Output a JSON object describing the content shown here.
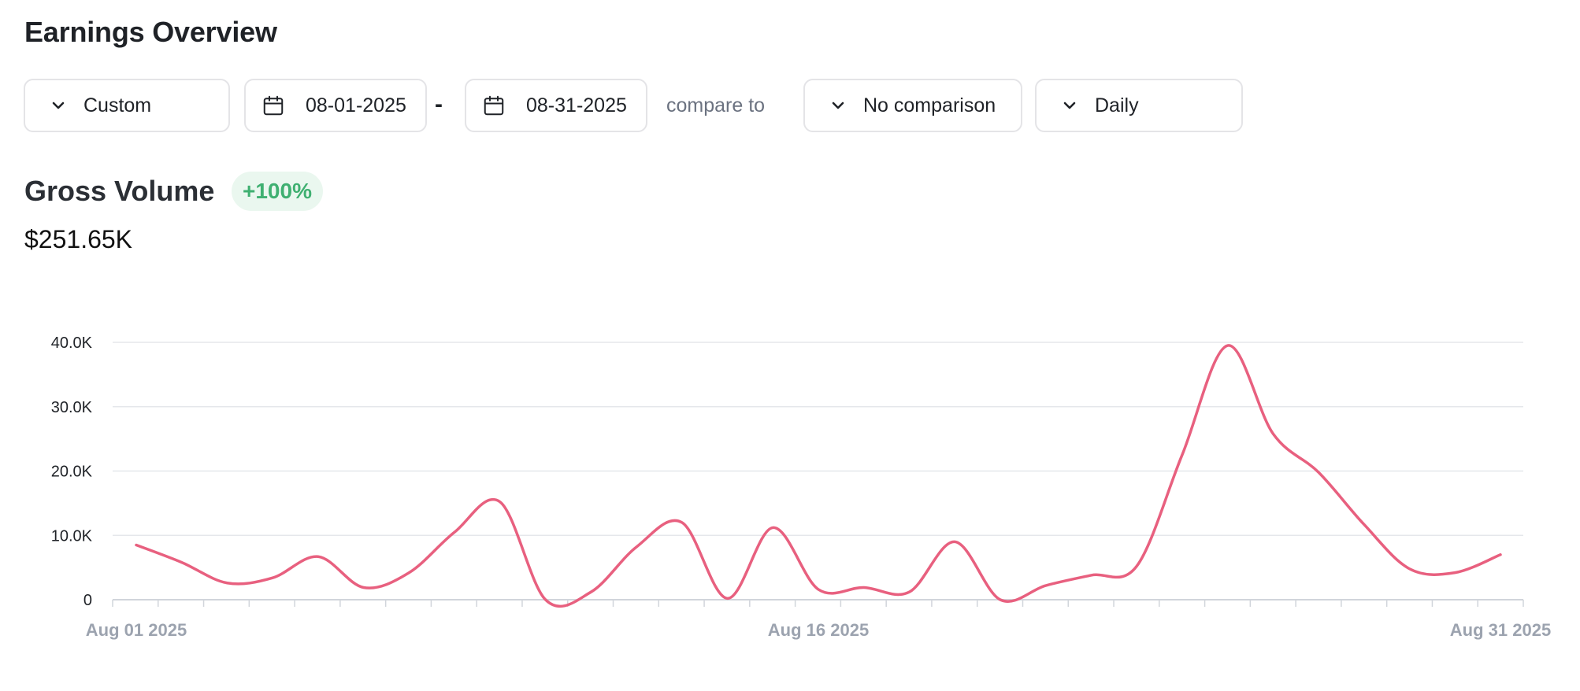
{
  "page": {
    "title": "Earnings Overview"
  },
  "filters": {
    "range_preset": "Custom",
    "start_date": "08-01-2025",
    "separator": "-",
    "end_date": "08-31-2025",
    "compare_label": "compare to",
    "comparison": "No comparison",
    "interval": "Daily"
  },
  "metric": {
    "title": "Gross Volume",
    "change_badge": "+100%",
    "value": "$251.65K"
  },
  "colors": {
    "line": "#e8607f",
    "badge_bg": "#eaf7ef",
    "badge_text": "#3fb071",
    "grid": "#e5e7eb",
    "axis_text": "#9ca3af"
  },
  "chart_data": {
    "type": "line",
    "x": [
      "Aug 01",
      "Aug 02",
      "Aug 03",
      "Aug 04",
      "Aug 05",
      "Aug 06",
      "Aug 07",
      "Aug 08",
      "Aug 09",
      "Aug 10",
      "Aug 11",
      "Aug 12",
      "Aug 13",
      "Aug 14",
      "Aug 15",
      "Aug 16",
      "Aug 17",
      "Aug 18",
      "Aug 19",
      "Aug 20",
      "Aug 21",
      "Aug 22",
      "Aug 23",
      "Aug 24",
      "Aug 25",
      "Aug 26",
      "Aug 27",
      "Aug 28",
      "Aug 29",
      "Aug 30",
      "Aug 31"
    ],
    "series": [
      {
        "values": [
          8500,
          5800,
          2600,
          3400,
          6700,
          1900,
          4200,
          10500,
          15200,
          0,
          1200,
          8200,
          12000,
          200,
          11200,
          1600,
          1900,
          1200,
          9000,
          0,
          2200,
          3800,
          5200,
          22500,
          39500,
          25800,
          19800,
          11700,
          4800,
          4200,
          7000
        ]
      }
    ],
    "y_ticks": [
      "0",
      "10.0K",
      "20.0K",
      "30.0K",
      "40.0K"
    ],
    "x_tick_labels": [
      "Aug 01 2025",
      "Aug 16 2025",
      "Aug 31 2025"
    ],
    "ylim": [
      0,
      40000
    ],
    "grid": true,
    "legend": "none"
  }
}
